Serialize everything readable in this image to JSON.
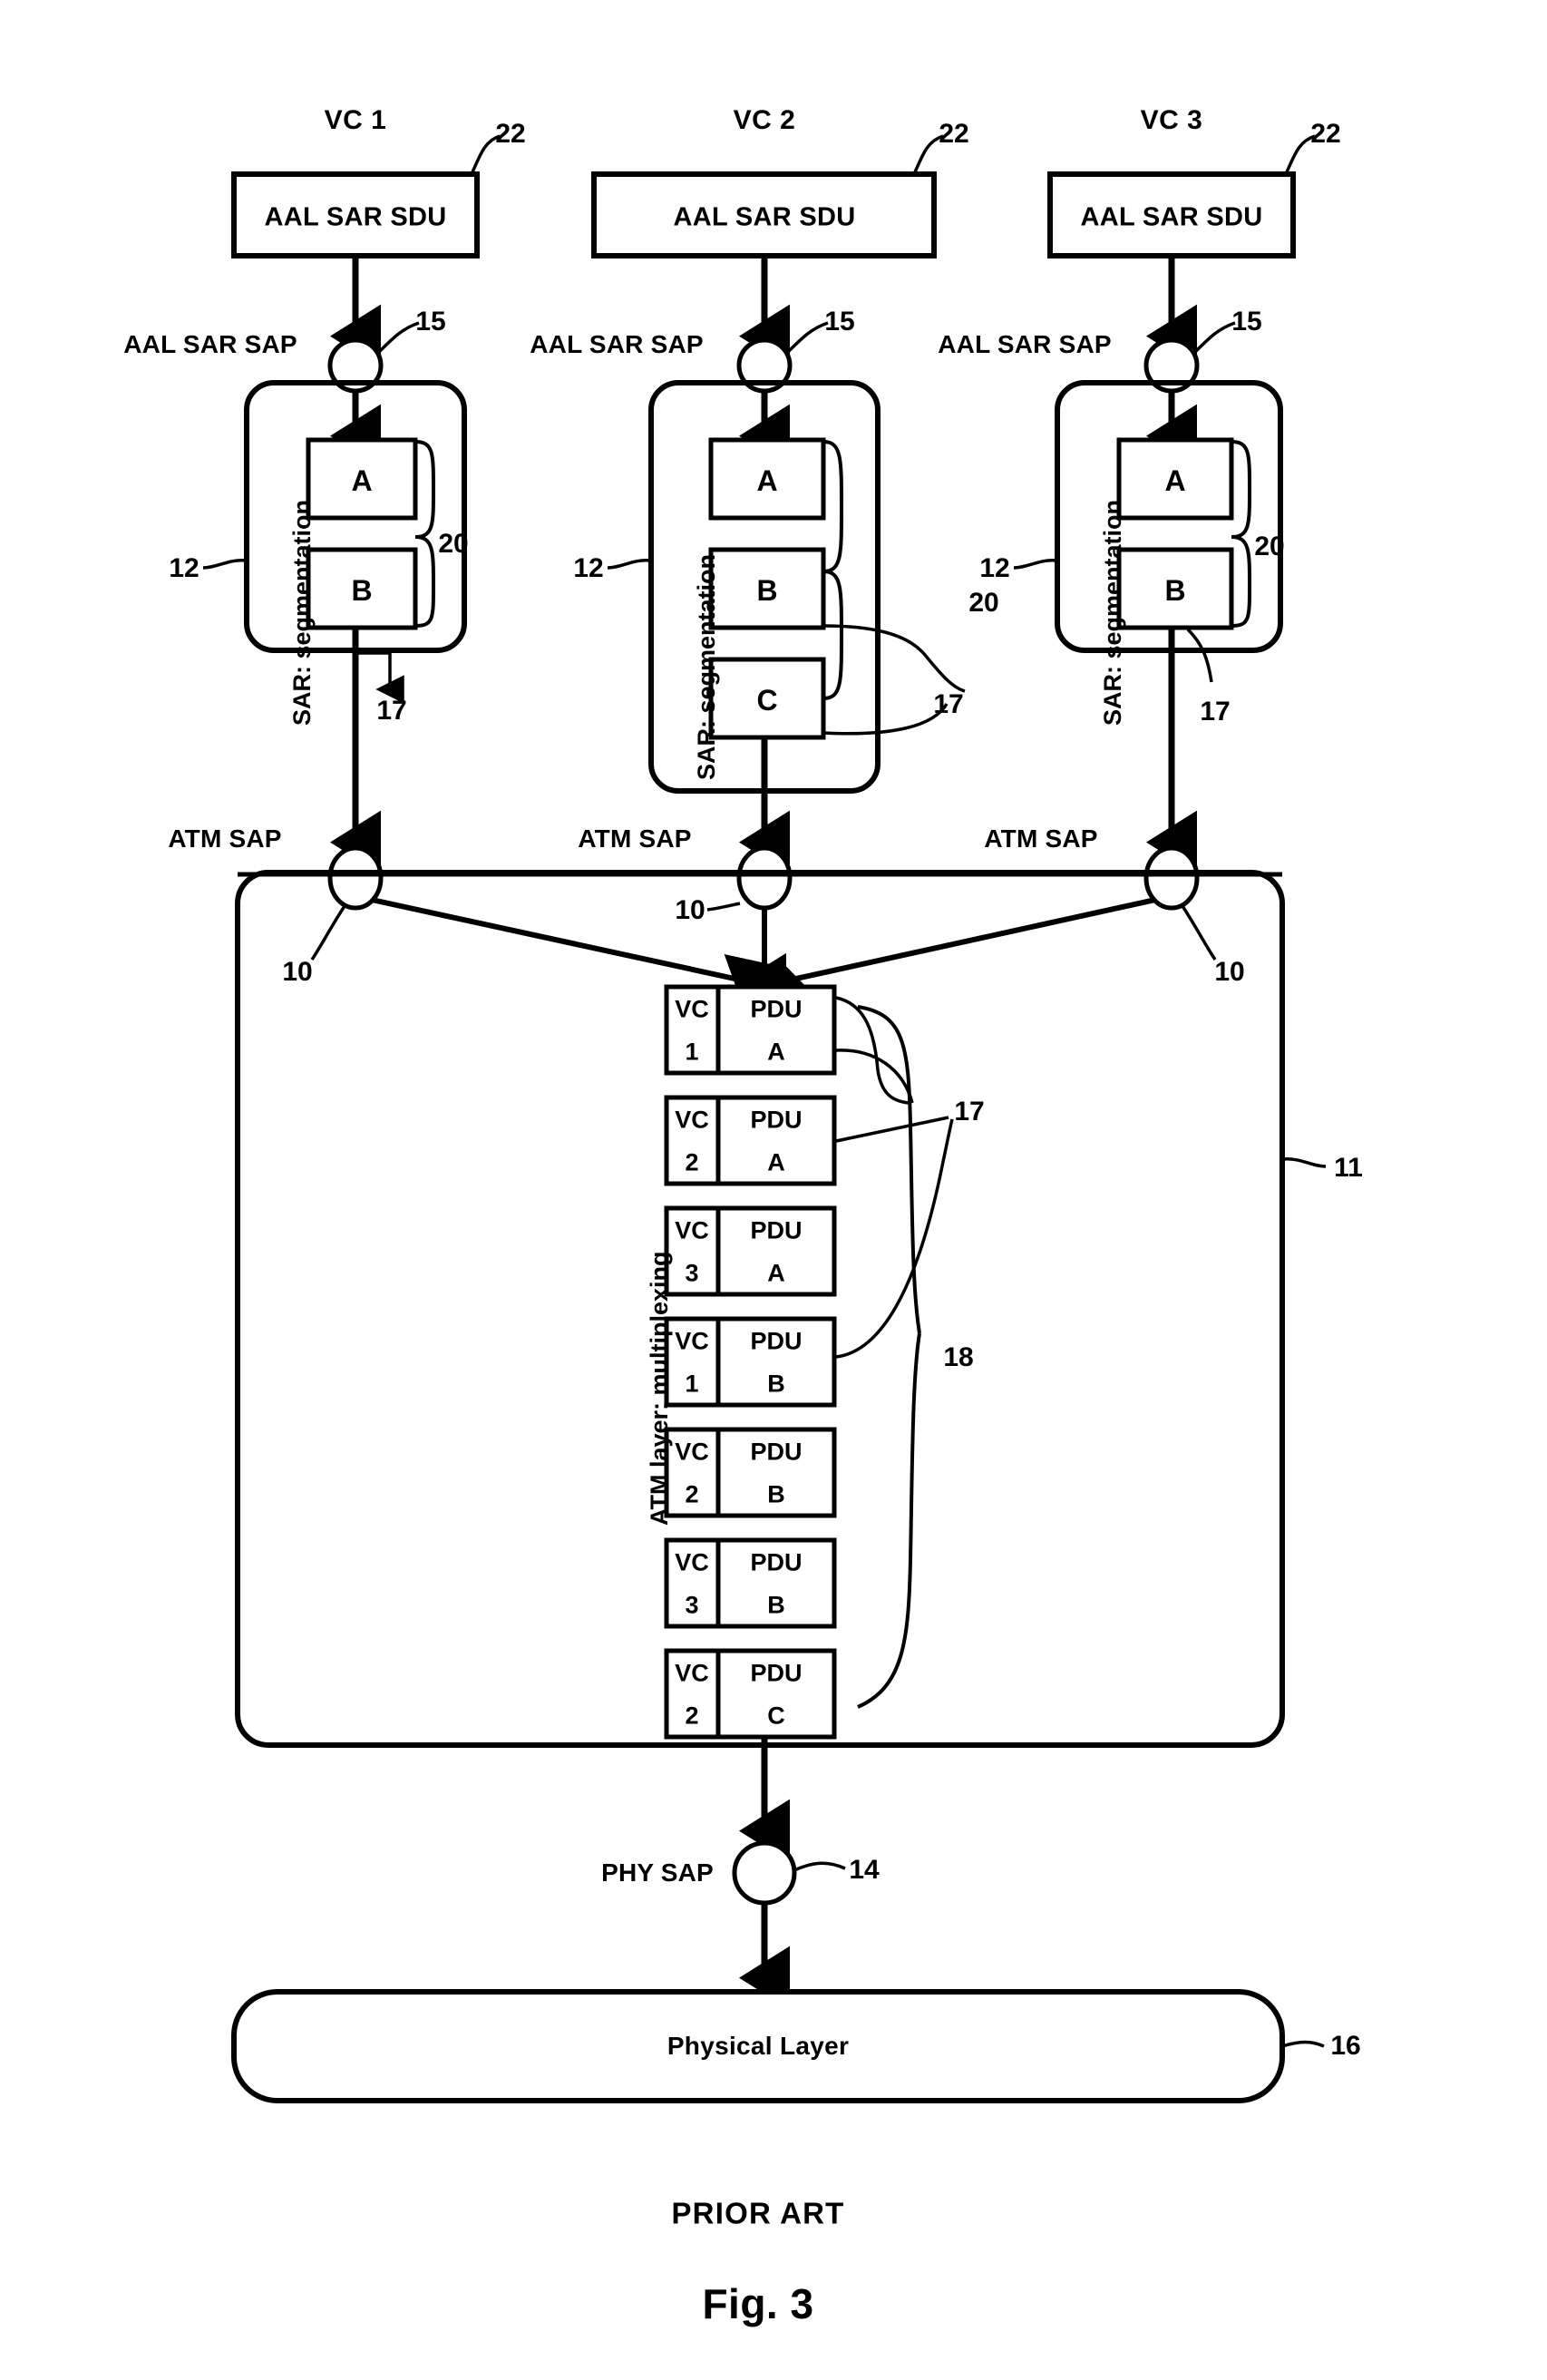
{
  "figure": {
    "caption": "Fig. 3",
    "note": "PRIOR ART"
  },
  "columns": [
    {
      "vc_title": "VC 1",
      "sdu_label": "AAL SAR SDU",
      "sdu_ref": "22",
      "aal_sap_label": "AAL SAR SAP",
      "aal_sap_ref": "15",
      "sar_label": "SAR: segmentation",
      "sar_ref": "12",
      "brace_ref": "20",
      "pdu_ref": "17",
      "segments": [
        "A",
        "B"
      ],
      "atm_sap_label": "ATM SAP",
      "atm_sap_ref": "10"
    },
    {
      "vc_title": "VC 2",
      "sdu_label": "AAL SAR SDU",
      "sdu_ref": "22",
      "aal_sap_label": "AAL SAR SAP",
      "aal_sap_ref": "15",
      "sar_label": "SAR: segmentation",
      "sar_ref": "12",
      "brace_ref": "20",
      "pdu_ref": "17",
      "segments": [
        "A",
        "B",
        "C"
      ],
      "atm_sap_label": "ATM SAP",
      "atm_sap_ref": "10"
    },
    {
      "vc_title": "VC 3",
      "sdu_label": "AAL SAR SDU",
      "sdu_ref": "22",
      "aal_sap_label": "AAL SAR SAP",
      "aal_sap_ref": "15",
      "sar_label": "SAR: segmentation",
      "sar_ref": "12",
      "brace_ref": "20",
      "pdu_ref": "17",
      "segments": [
        "A",
        "B"
      ],
      "atm_sap_label": "ATM SAP",
      "atm_sap_ref": "10"
    }
  ],
  "atm_layer": {
    "label": "ATM layer: multiplexing",
    "ref": "11",
    "cell_ref": "17",
    "queue_ref": "18",
    "cells": [
      {
        "vc_top": "VC",
        "vc_num": "1",
        "pdu_top": "PDU",
        "pdu_letter": "A"
      },
      {
        "vc_top": "VC",
        "vc_num": "2",
        "pdu_top": "PDU",
        "pdu_letter": "A"
      },
      {
        "vc_top": "VC",
        "vc_num": "3",
        "pdu_top": "PDU",
        "pdu_letter": "A"
      },
      {
        "vc_top": "VC",
        "vc_num": "1",
        "pdu_top": "PDU",
        "pdu_letter": "B"
      },
      {
        "vc_top": "VC",
        "vc_num": "2",
        "pdu_top": "PDU",
        "pdu_letter": "B"
      },
      {
        "vc_top": "VC",
        "vc_num": "3",
        "pdu_top": "PDU",
        "pdu_letter": "B"
      },
      {
        "vc_top": "VC",
        "vc_num": "2",
        "pdu_top": "PDU",
        "pdu_letter": "C"
      }
    ]
  },
  "phy": {
    "sap_label": "PHY SAP",
    "sap_ref": "14",
    "layer_label": "Physical Layer",
    "layer_ref": "16"
  },
  "colors": {
    "stroke": "#000000",
    "background": "#ffffff"
  }
}
